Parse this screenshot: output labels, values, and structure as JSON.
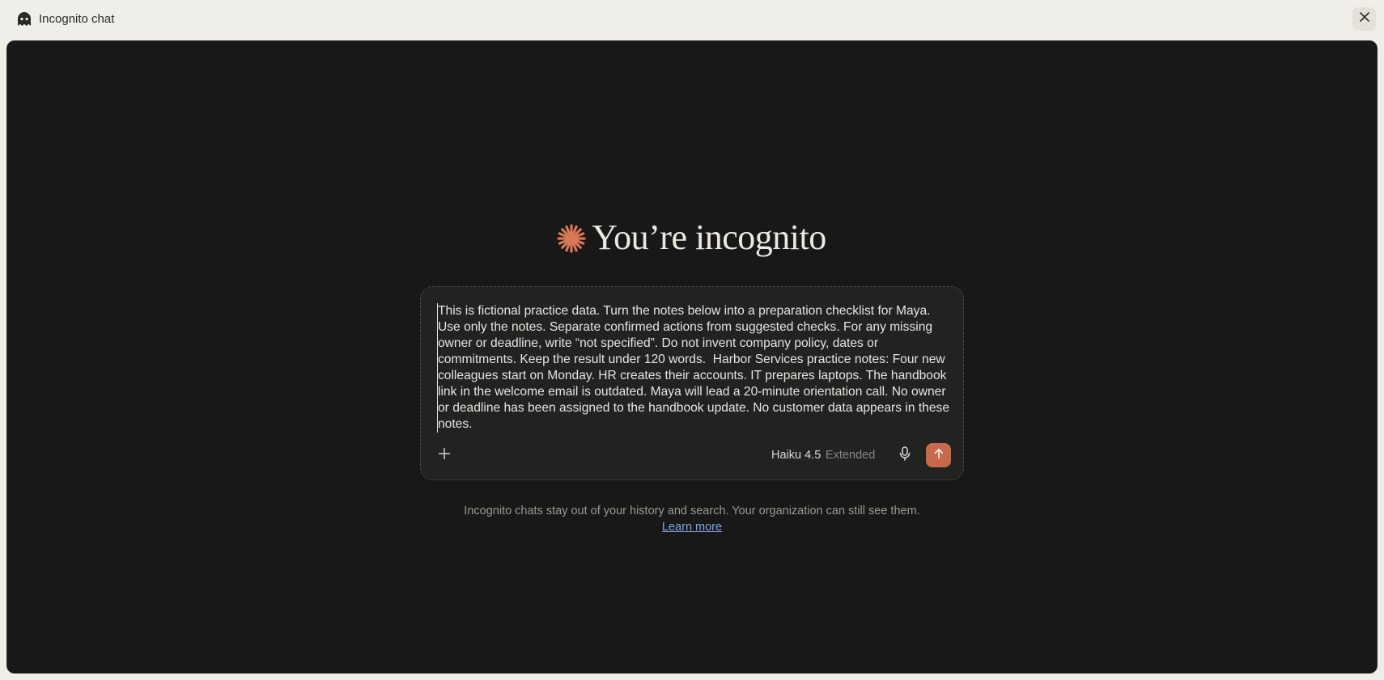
{
  "window": {
    "title": "Incognito chat",
    "icon": "ghost-icon",
    "close_icon": "close-icon"
  },
  "hero": {
    "icon": "spark-icon",
    "heading": "You’re incognito",
    "accent_color": "#d97757"
  },
  "composer": {
    "value": "This is fictional practice data. Turn the notes below into a preparation checklist for Maya. Use only the notes. Separate confirmed actions from suggested checks. For any missing owner or deadline, write “not specified”. Do not invent company policy, dates or commitments. Keep the result under 120 words.  Harbor Services practice notes: Four new colleagues start on Monday. HR creates their accounts. IT prepares laptops. The handbook link in the welcome email is outdated. Maya will lead a 20-minute orientation call. No owner or deadline has been assigned to the handbook update. No customer data appears in these notes.",
    "add_icon": "plus-icon",
    "model": "Haiku 4.5",
    "mode": "Extended",
    "mic_icon": "microphone-icon",
    "send_icon": "arrow-up-icon",
    "send_color": "#c76a4b"
  },
  "footer": {
    "notice": "Incognito chats stay out of your history and search. Your organization can still see them.",
    "link": "Learn more"
  }
}
